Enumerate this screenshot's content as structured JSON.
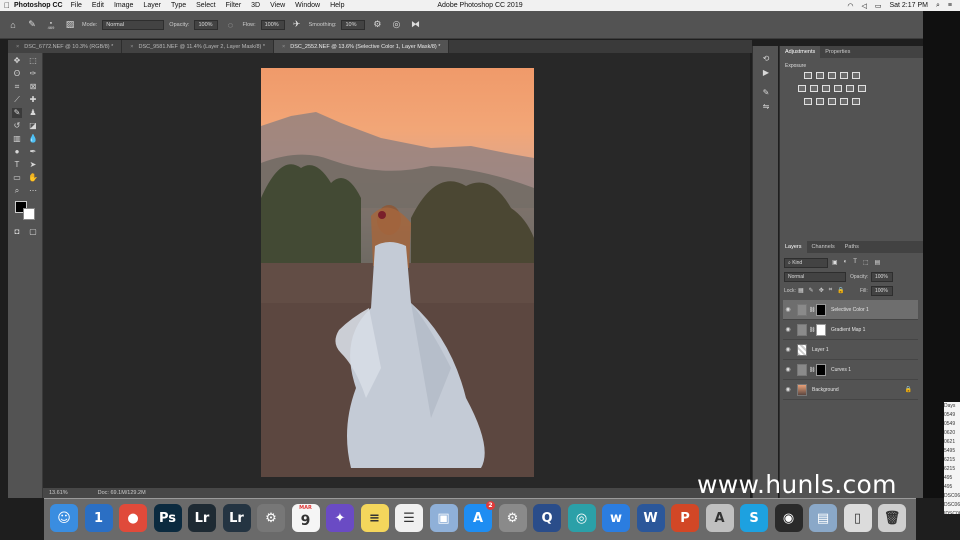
{
  "menubar": {
    "apple": "",
    "app": "Photoshop CC",
    "items": [
      "File",
      "Edit",
      "Image",
      "Layer",
      "Type",
      "Select",
      "Filter",
      "3D",
      "View",
      "Window",
      "Help"
    ],
    "window_title": "Adobe Photoshop CC 2019",
    "clock": "Sat 2:17 PM"
  },
  "options": {
    "brush_size": "469",
    "mode_label": "Mode:",
    "mode_value": "Normal",
    "opacity_label": "Opacity:",
    "opacity_value": "100%",
    "flow_label": "Flow:",
    "flow_value": "100%",
    "smoothing_label": "Smoothing:",
    "smoothing_value": "10%"
  },
  "tabs": [
    {
      "label": "DSC_6772.NEF @ 10.3% (RGB/8) *"
    },
    {
      "label": "DSC_9581.NEF @ 11.4% (Layer 2, Layer Mask/8) *"
    },
    {
      "label": "DSC_2552.NEF @ 13.6% (Selective Color 1, Layer Mask/8) *"
    }
  ],
  "status": {
    "zoom": "13.61%",
    "doc": "Doc: 69.1M/129.2M"
  },
  "adjustments": {
    "tab_adjustments": "Adjustments",
    "tab_properties": "Properties",
    "section_label": "Exposure"
  },
  "layers_panel": {
    "tab_layers": "Layers",
    "tab_channels": "Channels",
    "tab_paths": "Paths",
    "filter_kind": "Kind",
    "blend_mode": "Normal",
    "opacity_label": "Opacity:",
    "opacity_value": "100%",
    "lock_label": "Lock:",
    "fill_label": "Fill:",
    "fill_value": "100%",
    "layers": [
      {
        "name": "Selective Color 1"
      },
      {
        "name": "Gradient Map 1"
      },
      {
        "name": "Layer 1"
      },
      {
        "name": "Curves 1"
      },
      {
        "name": "Background"
      }
    ]
  },
  "dock": {
    "items": [
      {
        "name": "finder",
        "glyph": "☺",
        "color": "#3a8de0"
      },
      {
        "name": "1password",
        "glyph": "1",
        "color": "#2b6fc4"
      },
      {
        "name": "chrome",
        "glyph": "●",
        "color": "#e04a3a"
      },
      {
        "name": "photoshop",
        "glyph": "Ps",
        "color": "#0b2a3f"
      },
      {
        "name": "lightroom",
        "glyph": "Lr",
        "color": "#1e2a33"
      },
      {
        "name": "lightroom-classic",
        "glyph": "Lr",
        "color": "#243442"
      },
      {
        "name": "utility",
        "glyph": "⚙",
        "color": "#777777"
      },
      {
        "name": "calendar",
        "glyph": "9",
        "color": "#f5f5f5"
      },
      {
        "name": "photos-app",
        "glyph": "✦",
        "color": "#6a4bc4"
      },
      {
        "name": "notes",
        "glyph": "≡",
        "color": "#f4d65c"
      },
      {
        "name": "reminders",
        "glyph": "☰",
        "color": "#f0f0f0"
      },
      {
        "name": "preview",
        "glyph": "▣",
        "color": "#8fb0d8"
      },
      {
        "name": "app-store",
        "glyph": "A",
        "color": "#1e8df2"
      },
      {
        "name": "system-preferences",
        "glyph": "⚙",
        "color": "#8a8a8a"
      },
      {
        "name": "quicktime",
        "glyph": "Q",
        "color": "#2a4d8a"
      },
      {
        "name": "swirl-app",
        "glyph": "◎",
        "color": "#2ba0a8"
      },
      {
        "name": "wunderlist",
        "glyph": "w",
        "color": "#2b7de0"
      },
      {
        "name": "word",
        "glyph": "W",
        "color": "#2b579a"
      },
      {
        "name": "powerpoint",
        "glyph": "P",
        "color": "#d24726"
      },
      {
        "name": "acrobat",
        "glyph": "A",
        "color": "#c0c0c0"
      },
      {
        "name": "skype",
        "glyph": "S",
        "color": "#1da1e0"
      },
      {
        "name": "obs",
        "glyph": "◉",
        "color": "#2a2a2a"
      },
      {
        "name": "image-capture",
        "glyph": "▤",
        "color": "#8aa8c8"
      },
      {
        "name": "document",
        "glyph": "▯",
        "color": "#dcdcdc"
      },
      {
        "name": "trash",
        "glyph": "🗑",
        "color": "#cfcfcf"
      }
    ],
    "calendar_month": "MAR",
    "app_store_badge": "2"
  },
  "watermark": "www.hunls.com",
  "finder_list": [
    "Days",
    "0549",
    "0549",
    "0620",
    "0621",
    "5495",
    "6215",
    "6215",
    "495",
    "495",
    "DSC06215",
    "DSC06215",
    "IDSC0621",
    "arina y elisa",
    "DSC05406"
  ]
}
